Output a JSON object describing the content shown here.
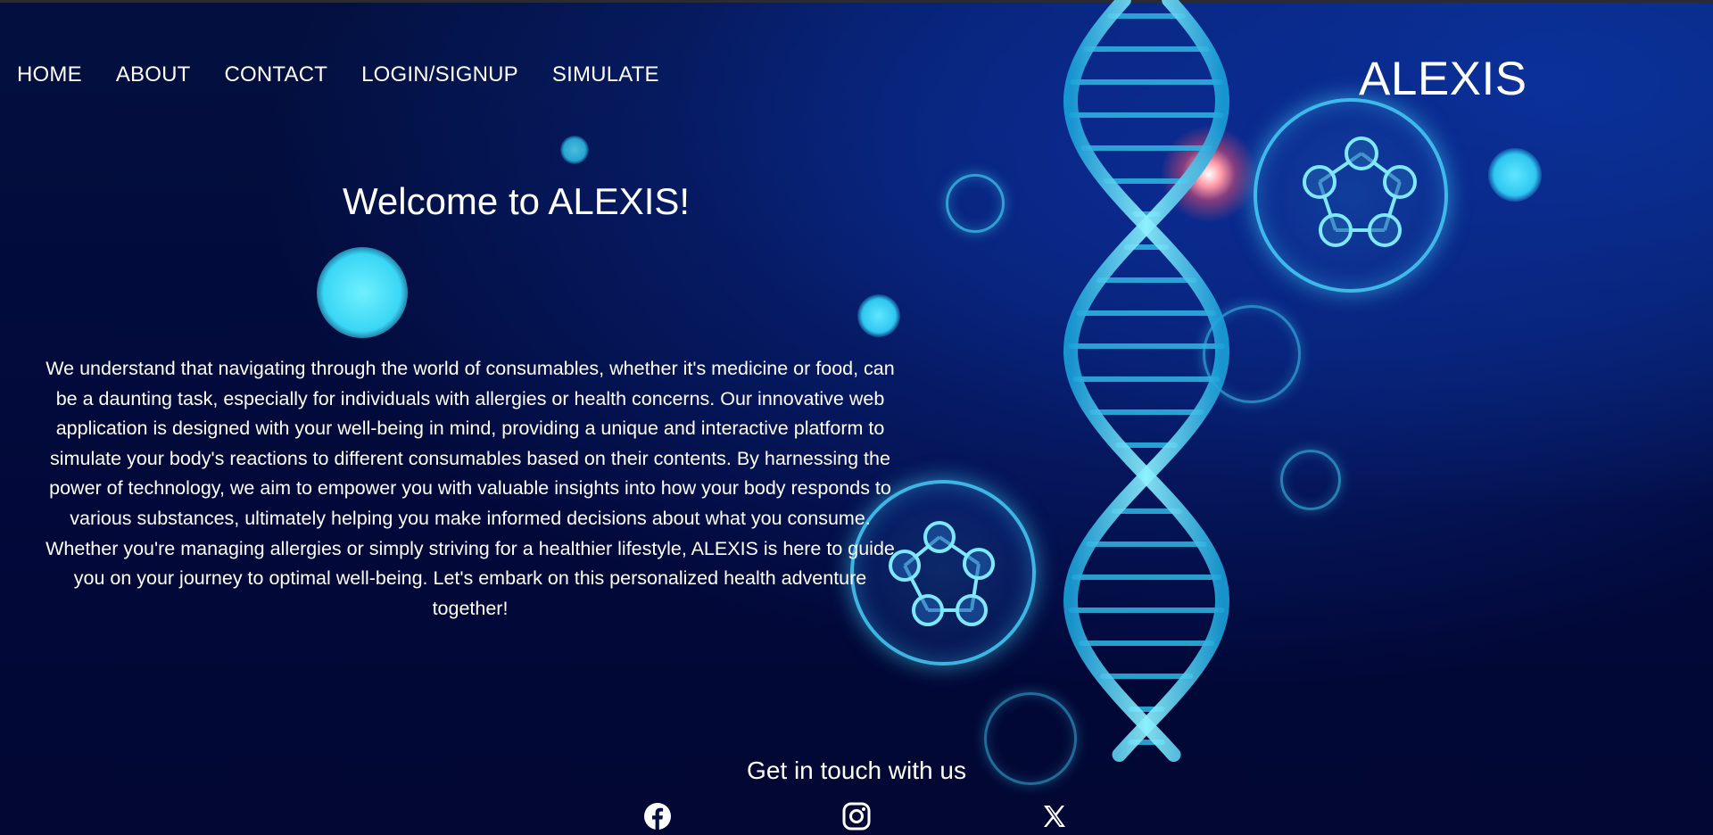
{
  "nav": {
    "items": [
      {
        "label": "HOME"
      },
      {
        "label": "ABOUT"
      },
      {
        "label": "CONTACT"
      },
      {
        "label": "LOGIN/SIGNUP"
      },
      {
        "label": "SIMULATE"
      }
    ]
  },
  "brand": "ALEXIS",
  "hero": {
    "title": "Welcome to ALEXIS!",
    "description": "We understand that navigating through the world of consumables, whether it's medicine or food, can be a daunting task, especially for individuals with allergies or health concerns. Our innovative web application is designed with your well-being in mind, providing a unique and interactive platform to simulate your body's reactions to different consumables based on their contents. By harnessing the power of technology, we aim to empower you with valuable insights into how your body responds to various substances, ultimately helping you make informed decisions about what you consume. Whether you're managing allergies or simply striving for a healthier lifestyle, ALEXIS is here to guide you on your journey to optimal well-being. Let's embark on this personalized health adventure together!"
  },
  "footer": {
    "title": "Get in touch with us",
    "social": [
      {
        "icon": "facebook-icon"
      },
      {
        "icon": "instagram-icon"
      },
      {
        "icon": "x-icon"
      }
    ]
  },
  "colors": {
    "background": "#020b3a",
    "text": "#ffffff",
    "accent": "#3cc8f0"
  }
}
